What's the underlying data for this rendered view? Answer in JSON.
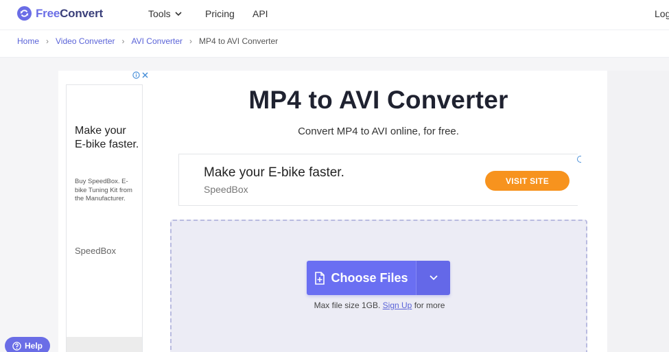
{
  "header": {
    "brand_part1": "Free",
    "brand_part2": "Convert",
    "nav": {
      "tools": "Tools",
      "pricing": "Pricing",
      "api": "API",
      "login": "Log"
    }
  },
  "breadcrumb": {
    "items": [
      "Home",
      "Video Converter",
      "AVI Converter"
    ],
    "current": "MP4 to AVI Converter"
  },
  "side_ad": {
    "headline": "Make your E-bike faster.",
    "description": "Buy SpeedBox. E-bike Tuning Kit from the Manufacturer.",
    "brand": "SpeedBox"
  },
  "main": {
    "title": "MP4 to AVI Converter",
    "subtitle": "Convert MP4 to AVI online, for free."
  },
  "banner_ad": {
    "headline": "Make your E-bike faster.",
    "brand": "SpeedBox",
    "cta": "VISIT SITE"
  },
  "upload": {
    "button_label": "Choose Files",
    "max_size_prefix": "Max file size 1GB.",
    "signup_link": "Sign Up",
    "max_size_suffix": "for more"
  },
  "help": {
    "label": "Help"
  },
  "colors": {
    "brand": "#6a6de6",
    "cta": "#f7931e",
    "link": "#5a63d8"
  }
}
